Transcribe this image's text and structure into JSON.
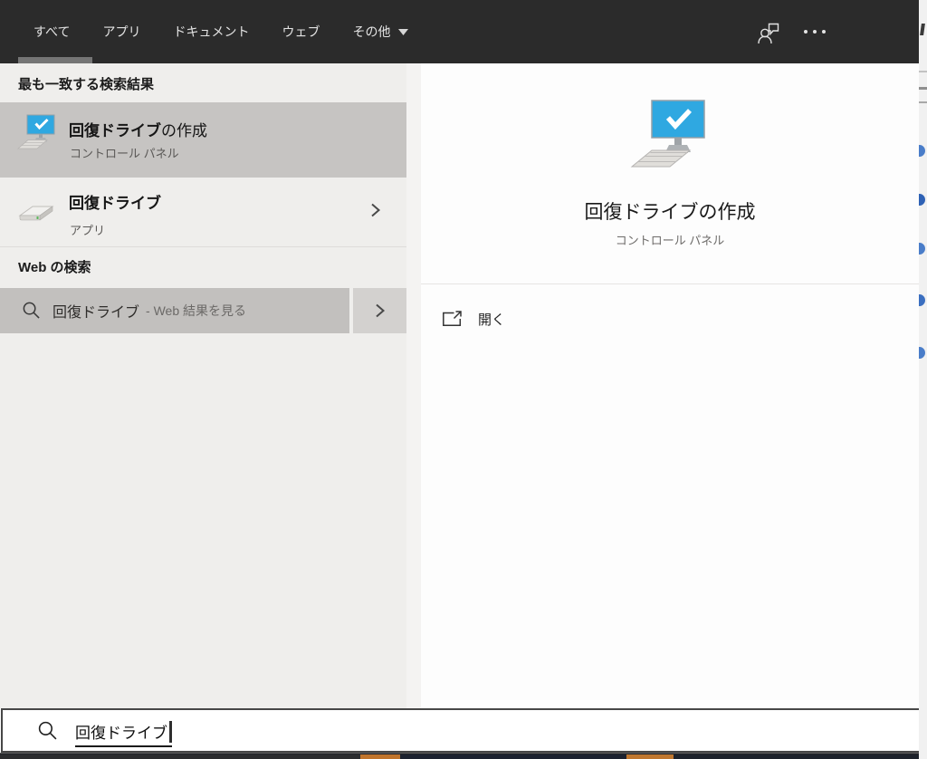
{
  "header": {
    "tabs": [
      {
        "label": "すべて",
        "active": true
      },
      {
        "label": "アプリ",
        "active": false
      },
      {
        "label": "ドキュメント",
        "active": false
      },
      {
        "label": "ウェブ",
        "active": false
      },
      {
        "label": "その他",
        "active": false,
        "has_dropdown": true
      }
    ]
  },
  "left_panel": {
    "best_match_header": "最も一致する検索結果",
    "best_match": {
      "title_match": "回復ドライブ",
      "title_rest": "の作成",
      "subtitle": "コントロール パネル",
      "icon": "recovery-drive-icon"
    },
    "app_result": {
      "title": "回復ドライブ",
      "subtitle": "アプリ",
      "icon": "hard-drive-icon"
    },
    "web_section_header": "Web の検索",
    "web_result": {
      "query": "回復ドライブ",
      "suffix": "- Web 結果を見る",
      "icon": "search-icon"
    }
  },
  "right_panel": {
    "title": "回復ドライブの作成",
    "subtitle": "コントロール パネル",
    "icon": "recovery-drive-icon",
    "actions": [
      {
        "label": "開く",
        "icon": "open-external-icon"
      }
    ]
  },
  "search_bar": {
    "value": "回復ドライブ",
    "ime_composition": true
  },
  "colors": {
    "topbar_bg": "#2b2b2b",
    "panel_bg": "#efeeec",
    "selected_row_bg": "#c6c4c2",
    "web_row_bg": "#c2c0be",
    "accent_blue": "#2fa8e1",
    "taskbar_orange": "#c0742c"
  }
}
